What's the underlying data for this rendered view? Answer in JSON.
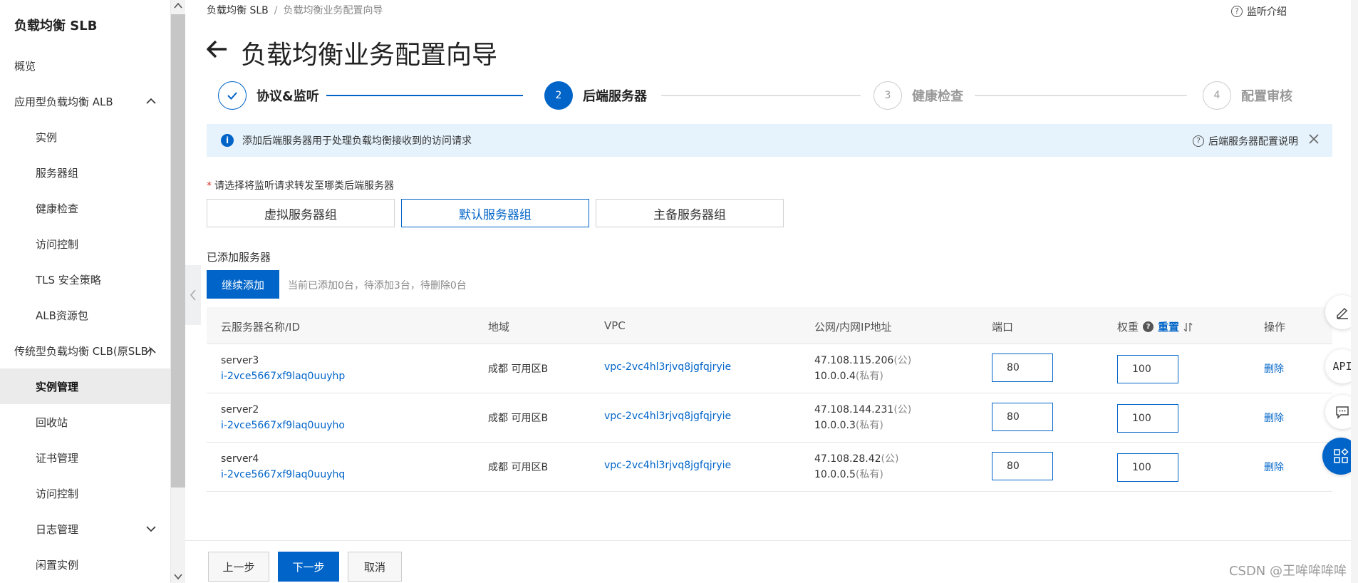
{
  "sidebar": {
    "title": "负载均衡 SLB",
    "items": [
      {
        "label": "概览"
      },
      {
        "label": "应用型负载均衡 ALB"
      },
      {
        "label": "实例"
      },
      {
        "label": "服务器组"
      },
      {
        "label": "健康检查"
      },
      {
        "label": "访问控制"
      },
      {
        "label": "TLS 安全策略"
      },
      {
        "label": "ALB资源包"
      },
      {
        "label": "传统型负载均衡 CLB(原SLB)"
      },
      {
        "label": "实例管理"
      },
      {
        "label": "回收站"
      },
      {
        "label": "证书管理"
      },
      {
        "label": "访问控制"
      },
      {
        "label": "日志管理"
      },
      {
        "label": "闲置实例"
      }
    ]
  },
  "header": {
    "breadcrumb": [
      "负载均衡 SLB",
      "负载均衡业务配置向导"
    ],
    "help_label": "监听介绍",
    "title": "负载均衡业务配置向导"
  },
  "steps": [
    {
      "label": "协议&监听",
      "state": "done"
    },
    {
      "label": "后端服务器",
      "state": "active",
      "num": "2"
    },
    {
      "label": "健康检查",
      "state": "pending",
      "num": "3"
    },
    {
      "label": "配置审核",
      "state": "pending",
      "num": "4"
    }
  ],
  "banner": {
    "text": "添加后端服务器用于处理负载均衡接收到的访问请求",
    "help_label": "后端服务器配置说明"
  },
  "form": {
    "required_label": "请选择将监听请求转发至哪类后端服务器",
    "server_types": [
      "虚拟服务器组",
      "默认服务器组",
      "主备服务器组"
    ],
    "selected_type": "默认服务器组",
    "added_label": "已添加服务器",
    "add_button": "继续添加",
    "count_text": "当前已添加0台，待添加3台，待删除0台"
  },
  "table": {
    "headers": {
      "name": "云服务器名称/ID",
      "region": "地域",
      "vpc": "VPC",
      "ip": "公网/内网IP地址",
      "port": "端口",
      "weight": "权重",
      "reset": "重置",
      "action": "操作"
    },
    "rows": [
      {
        "name": "server3",
        "id": "i-2vce5667xf9laq0uuyhp",
        "region": "成都 可用区B",
        "vpc": "vpc-2vc4hl3rjvq8jgfqjryie",
        "public_ip": "47.108.115.206",
        "public_tag": "(公)",
        "private_ip": "10.0.0.4",
        "private_tag": "(私有)",
        "port": "80",
        "weight": "100",
        "action": "删除"
      },
      {
        "name": "server2",
        "id": "i-2vce5667xf9laq0uuyho",
        "region": "成都 可用区B",
        "vpc": "vpc-2vc4hl3rjvq8jgfqjryie",
        "public_ip": "47.108.144.231",
        "public_tag": "(公)",
        "private_ip": "10.0.0.3",
        "private_tag": "(私有)",
        "port": "80",
        "weight": "100",
        "action": "删除"
      },
      {
        "name": "server4",
        "id": "i-2vce5667xf9laq0uuyhq",
        "region": "成都 可用区B",
        "vpc": "vpc-2vc4hl3rjvq8jgfqjryie",
        "public_ip": "47.108.28.42",
        "public_tag": "(公)",
        "private_ip": "10.0.0.5",
        "private_tag": "(私有)",
        "port": "80",
        "weight": "100",
        "action": "删除"
      }
    ]
  },
  "footer": {
    "prev": "上一步",
    "next": "下一步",
    "cancel": "取消",
    "watermark": "CSDN @王哞哞哞哞"
  },
  "float_toolbar": {
    "api_label": "API"
  },
  "colors": {
    "primary": "#0064c8",
    "banner_bg": "#e6f3fc",
    "active_menu_bg": "#ebebeb",
    "notification_dot": "#ff6a00"
  }
}
